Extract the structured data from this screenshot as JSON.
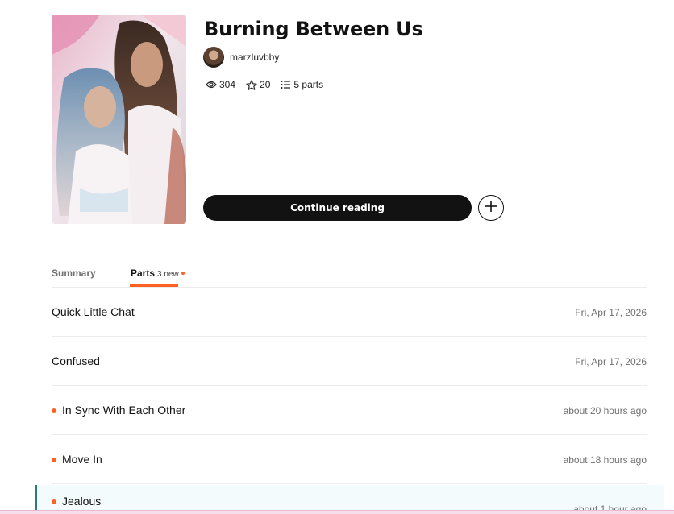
{
  "story": {
    "title": "Burning Between Us",
    "author": "marzluvbby",
    "stats": {
      "reads": "304",
      "votes": "20",
      "parts": "5 parts"
    },
    "continue_label": "Continue reading"
  },
  "tabs": {
    "summary_label": "Summary",
    "parts_label": "Parts",
    "parts_new": "3 new"
  },
  "parts": [
    {
      "title": "Quick Little Chat",
      "date": "Fri, Apr 17, 2026",
      "is_new": false
    },
    {
      "title": "Confused",
      "date": "Fri, Apr 17, 2026",
      "is_new": false
    },
    {
      "title": "In Sync With Each Other",
      "date": "about 20 hours ago",
      "is_new": true
    },
    {
      "title": "Move In",
      "date": "about 18 hours ago",
      "is_new": true
    },
    {
      "title": "Jealous",
      "date": "about 1 hour ago",
      "is_new": true
    }
  ],
  "colors": {
    "accent": "#ff6122",
    "button": "#121212",
    "active_bar": "#2c7a70"
  },
  "icons": {
    "reads": "eye-icon",
    "votes": "star-icon",
    "parts": "list-icon",
    "add": "plus-icon"
  }
}
